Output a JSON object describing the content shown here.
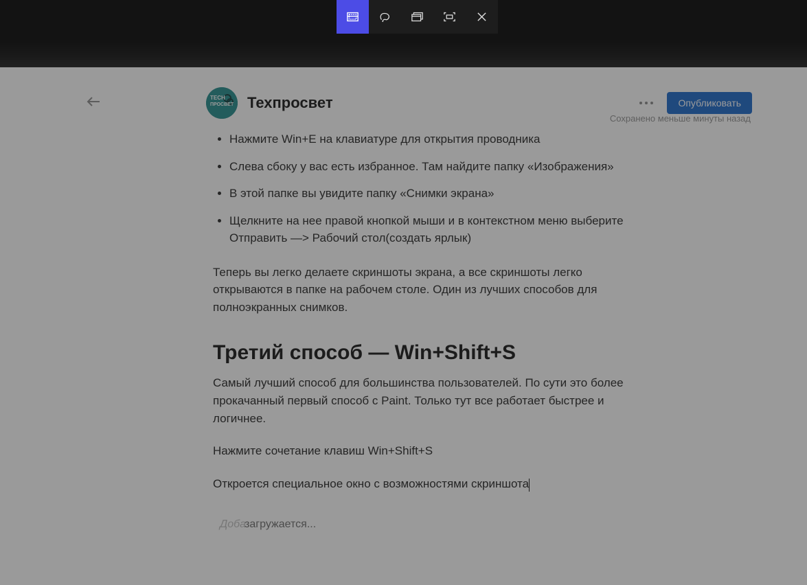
{
  "header": {
    "channel_name": "Техпросвет",
    "publish_label": "Опубликовать",
    "saved_text": "Сохранено меньше минуты назад",
    "avatar_text": "TECH\nПРОСВЕТ"
  },
  "article": {
    "list_items": [
      "Нажмите Win+E на клавиатуре для открытия проводника",
      "Слева сбоку у вас есть избранное. Там найдите папку «Изображения»",
      "В этой папке вы увидите папку «Снимки экрана»",
      "Щелкните на нее правой кнопкой мыши и в контекстном меню выберите Отправить —> Рабочий стол(создать ярлык)"
    ],
    "para1": "Теперь вы легко делаете скриншоты экрана, а все скриншоты легко открываются в папке на рабочем столе. Один из лучших способов для полноэкранных снимков.",
    "h2": "Третий способ — Win+Shift+S",
    "para2": "Самый лучший способ для большинства пользователей. По сути это более прокачанный первый способ с Paint. Только тут все работает быстрее и логичнее.",
    "para3": "Нажмите сочетание клавиш Win+Shift+S",
    "para4": "Откроется специальное окно с возможностями скриншота"
  },
  "footer": {
    "add_block_placeholder": "Доба",
    "loading": "загружается..."
  },
  "snip_toolbar": {
    "icons": [
      "rectangular-snip-icon",
      "freeform-snip-icon",
      "window-snip-icon",
      "fullscreen-snip-icon",
      "close-icon"
    ]
  }
}
